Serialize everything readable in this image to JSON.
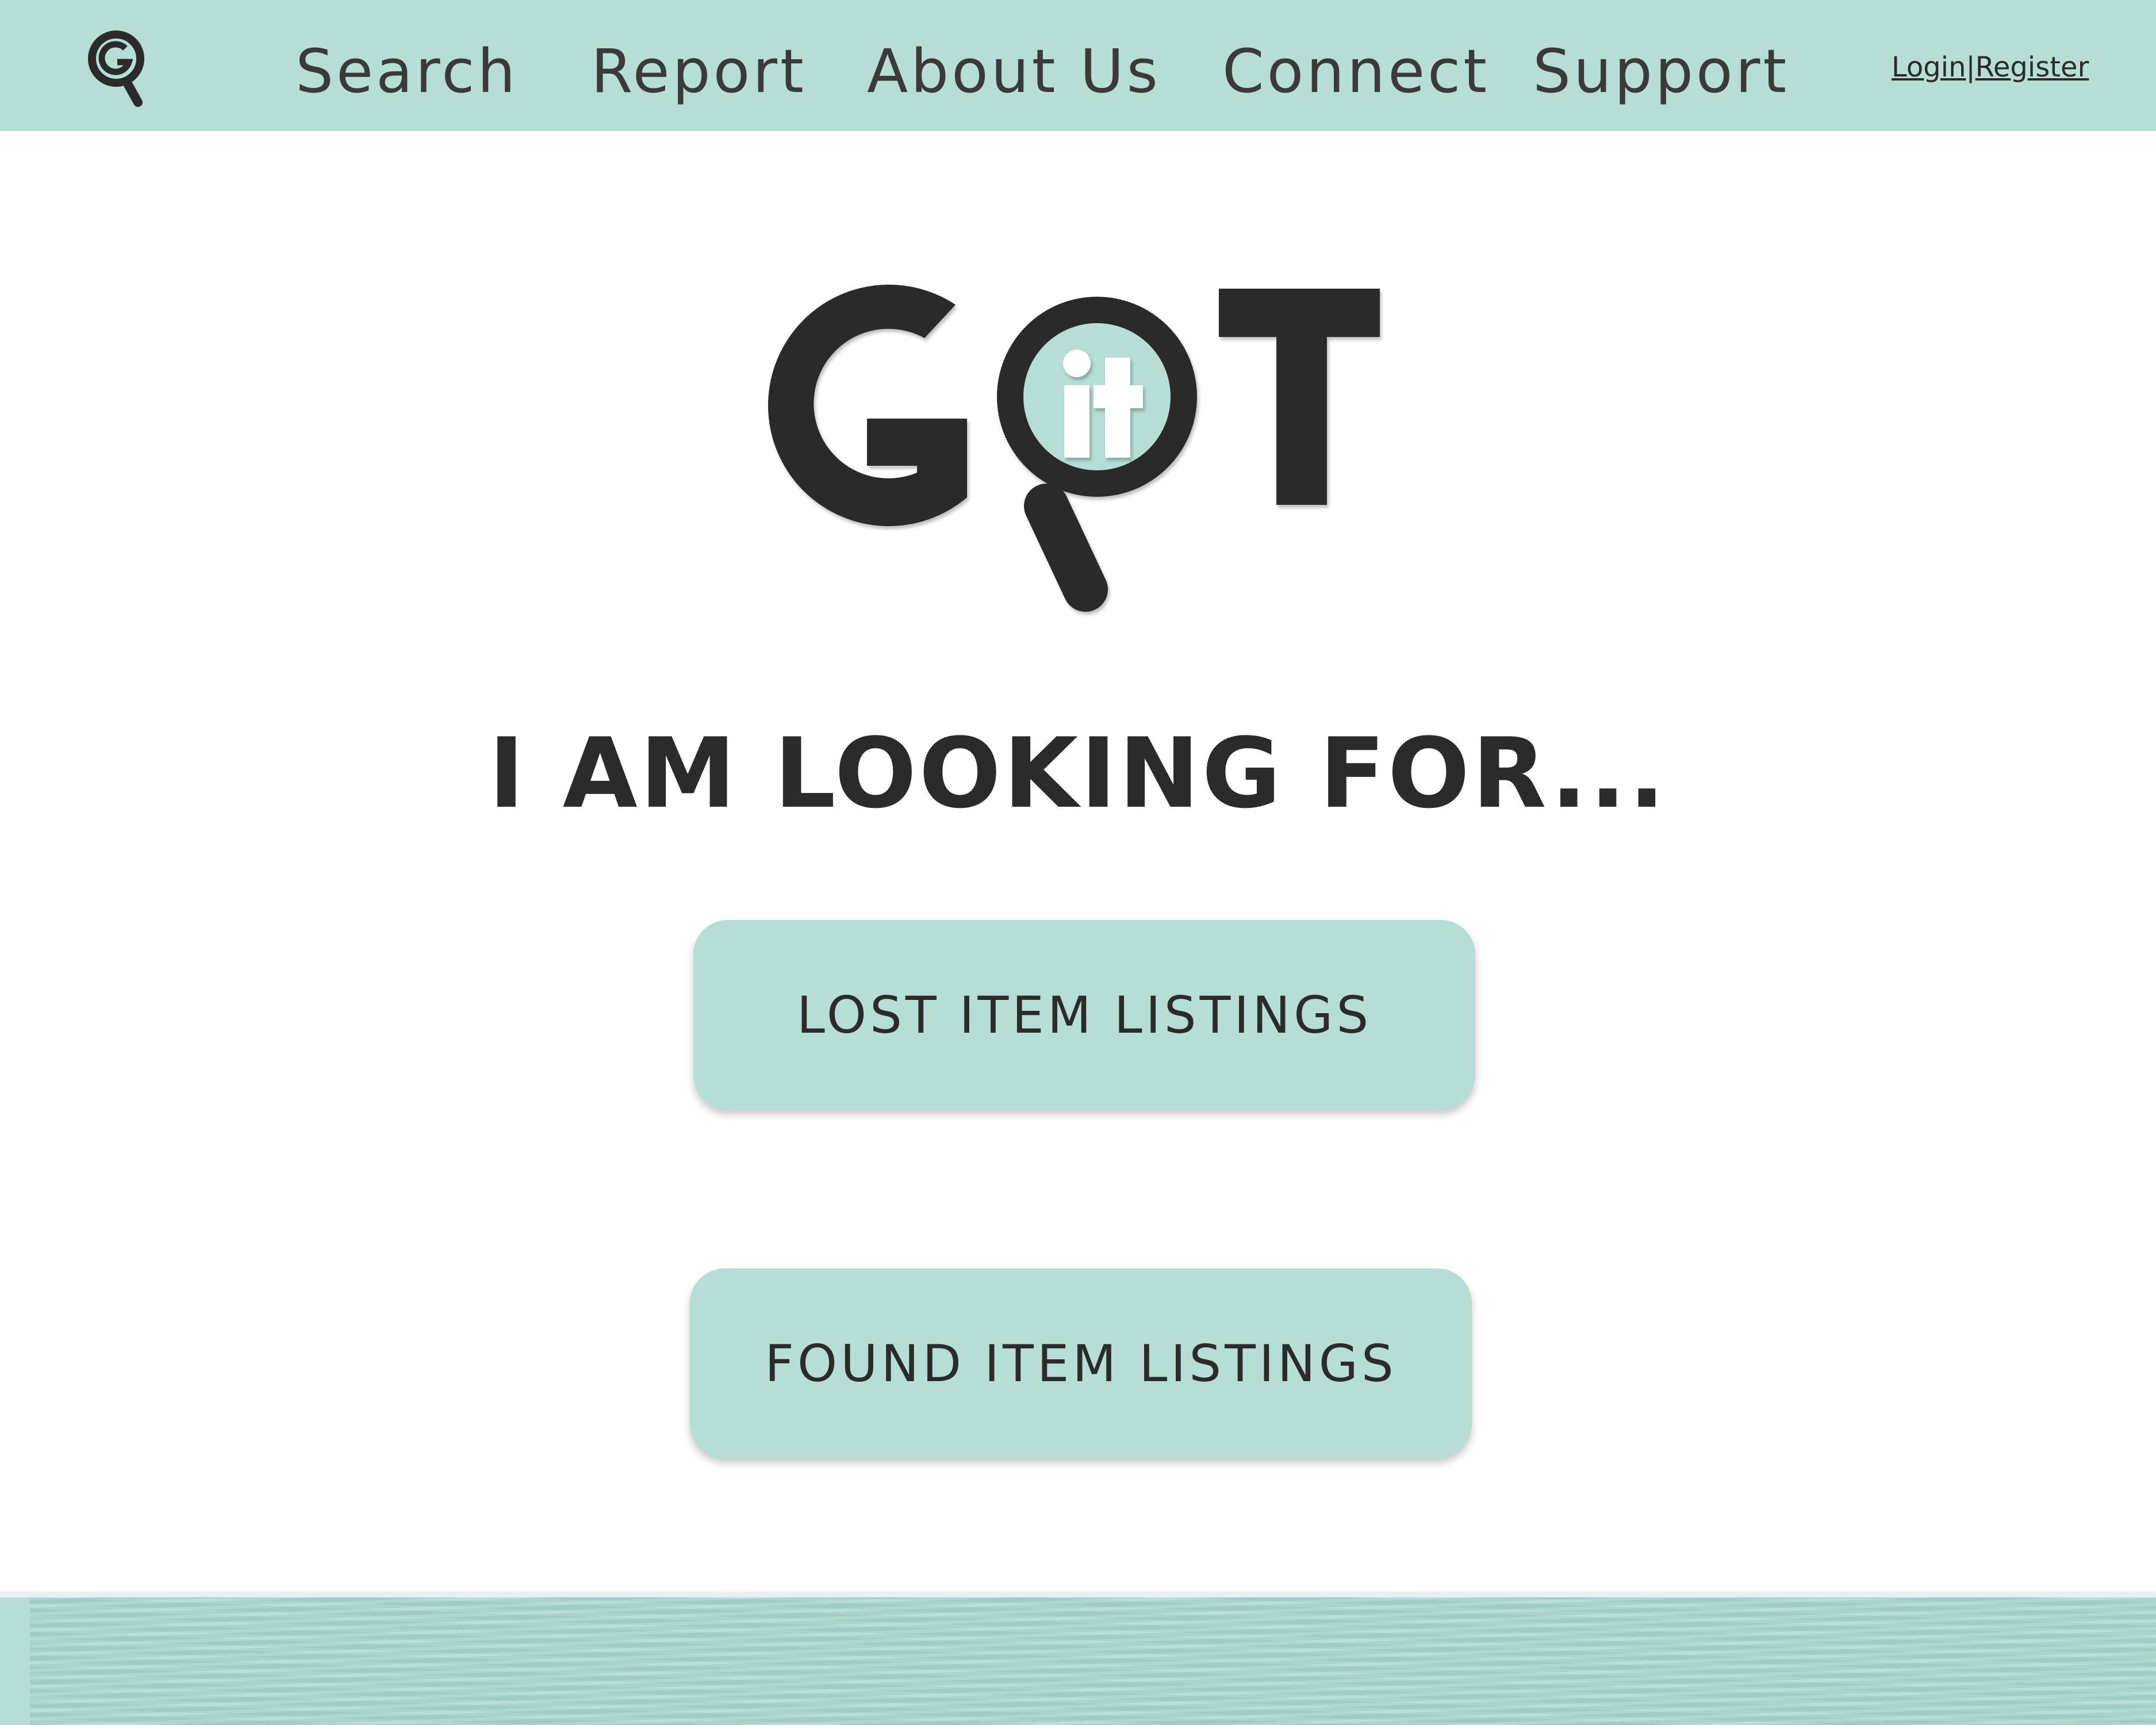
{
  "brand": {
    "logo_text": "GOT it",
    "colors": {
      "accent": "#b6ded7",
      "dark": "#2b2b2b",
      "background": "#ffffff"
    }
  },
  "nav": {
    "logo_icon": "g-magnifier-icon",
    "items": [
      {
        "label": "Search"
      },
      {
        "label": "Report"
      },
      {
        "label": "About Us"
      },
      {
        "label": "Connect"
      },
      {
        "label": "Support"
      }
    ],
    "auth": {
      "login": "Login",
      "separator": "|",
      "register": "Register"
    }
  },
  "main": {
    "heading": "I AM LOOKING FOR...",
    "buttons": {
      "lost": "LOST ITEM LISTINGS",
      "found": "FOUND ITEM LISTINGS"
    }
  }
}
